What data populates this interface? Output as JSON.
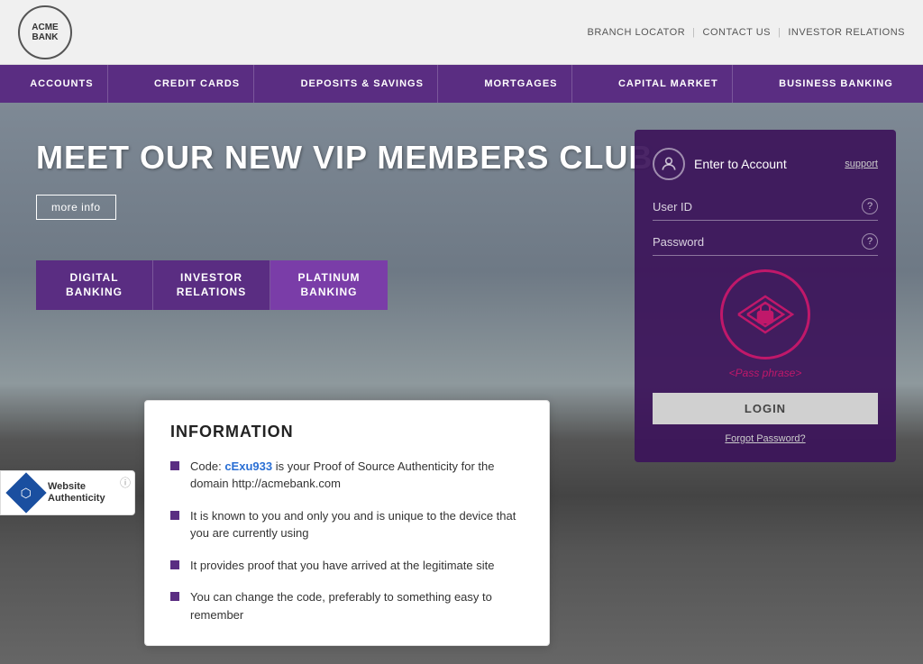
{
  "top_bar": {
    "logo_line1": "ACME",
    "logo_line2": "BANK",
    "links": [
      {
        "label": "BRANCH LOCATOR"
      },
      {
        "label": "CONTACT US"
      },
      {
        "label": "INVESTOR RELATIONS"
      }
    ],
    "separator": "|"
  },
  "nav": {
    "items": [
      {
        "label": "ACCOUNTS"
      },
      {
        "label": "CREDIT CARDS"
      },
      {
        "label": "DEPOSITS & SAVINGS"
      },
      {
        "label": "MORTGAGES"
      },
      {
        "label": "CAPITAL MARKET"
      },
      {
        "label": "BUSINESS BANKING"
      }
    ]
  },
  "hero": {
    "title": "MEET OUR NEW VIP MEMBERS CLUB",
    "more_info_label": "more info",
    "tabs": [
      {
        "label": "DIGITAL\nBANKING",
        "active": false
      },
      {
        "label": "INVESTOR\nRELATIONS",
        "active": false
      },
      {
        "label": "PLATINUM\nBANKING",
        "active": true
      }
    ]
  },
  "login_panel": {
    "enter_account": "Enter to Account",
    "support_label": "support",
    "user_id_label": "User ID",
    "password_label": "Password",
    "passphrase_text": "<Pass phrase>",
    "login_button": "LOGIN",
    "forgot_password": "Forgot Password?"
  },
  "authenticity_widget": {
    "label": "Website\nAuthenticity",
    "info_icon": "ⓘ"
  },
  "info_popup": {
    "title": "INFORMATION",
    "items": [
      {
        "text_before_code": "Code: ",
        "code": "cExu933",
        "text_after_code": " is your Proof of Source Authenticity for the domain http://acmebank.com"
      },
      {
        "text": "It is known to you and only you and is unique to the device that you are currently using"
      },
      {
        "text": "It provides proof that you have arrived at the legitimate site"
      },
      {
        "text": "You can change the code, preferably to something easy to remember"
      }
    ]
  }
}
